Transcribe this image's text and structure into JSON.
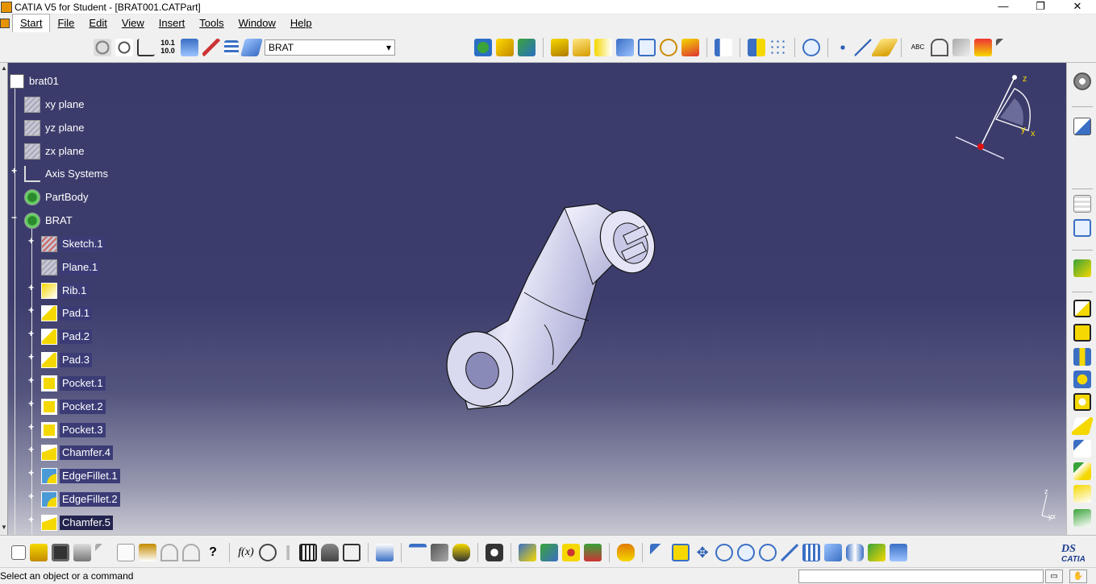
{
  "window": {
    "title": "CATIA V5 for Student - [BRAT001.CATPart]",
    "min_glyph": "—",
    "max_glyph": "❐",
    "close_glyph": "✕"
  },
  "menu": {
    "items": [
      "Start",
      "File",
      "Edit",
      "View",
      "Insert",
      "Tools",
      "Window",
      "Help"
    ],
    "doc_min": "_",
    "doc_restore": "❐",
    "doc_close": "✕"
  },
  "toolbar": {
    "body_combo_value": "BRAT",
    "combo_arrow": "▾"
  },
  "compass": {
    "z": "z",
    "y": "y",
    "x": "x"
  },
  "axis_mini": {
    "z": "z",
    "yx": "yx"
  },
  "tree": {
    "root": "brat01",
    "items": [
      {
        "label": "xy plane",
        "icon": "plane-icon"
      },
      {
        "label": "yz plane",
        "icon": "plane-icon"
      },
      {
        "label": "zx plane",
        "icon": "plane-icon"
      },
      {
        "label": "Axis Systems",
        "icon": "axis-icon"
      },
      {
        "label": "PartBody",
        "icon": "body-gear-icon"
      },
      {
        "label": "BRAT",
        "icon": "body-gear-icon"
      },
      {
        "label": "Sketch.1",
        "icon": "sketch-icon"
      },
      {
        "label": "Plane.1",
        "icon": "plane-icon"
      },
      {
        "label": "Rib.1",
        "icon": "rib-icon"
      },
      {
        "label": "Pad.1",
        "icon": "pad-icon"
      },
      {
        "label": "Pad.2",
        "icon": "pad-icon"
      },
      {
        "label": "Pad.3",
        "icon": "pad-icon"
      },
      {
        "label": "Pocket.1",
        "icon": "pocket-icon"
      },
      {
        "label": "Pocket.2",
        "icon": "pocket-icon"
      },
      {
        "label": "Pocket.3",
        "icon": "pocket-icon"
      },
      {
        "label": "Chamfer.4",
        "icon": "chamfer-icon"
      },
      {
        "label": "EdgeFillet.1",
        "icon": "fillet-icon"
      },
      {
        "label": "EdgeFillet.2",
        "icon": "fillet-icon"
      },
      {
        "label": "Chamfer.5",
        "icon": "chamfer-icon"
      }
    ]
  },
  "status": {
    "message": "Select an object or a command",
    "btn1": "▭",
    "btn2": "✋"
  },
  "brand": {
    "logo_text": "CATIA",
    "logo_mark": "DS"
  },
  "colors": {
    "accent_yellow": "#f5d800",
    "viewport_top": "#3b3b6b",
    "tree_text": "#ffffff"
  }
}
